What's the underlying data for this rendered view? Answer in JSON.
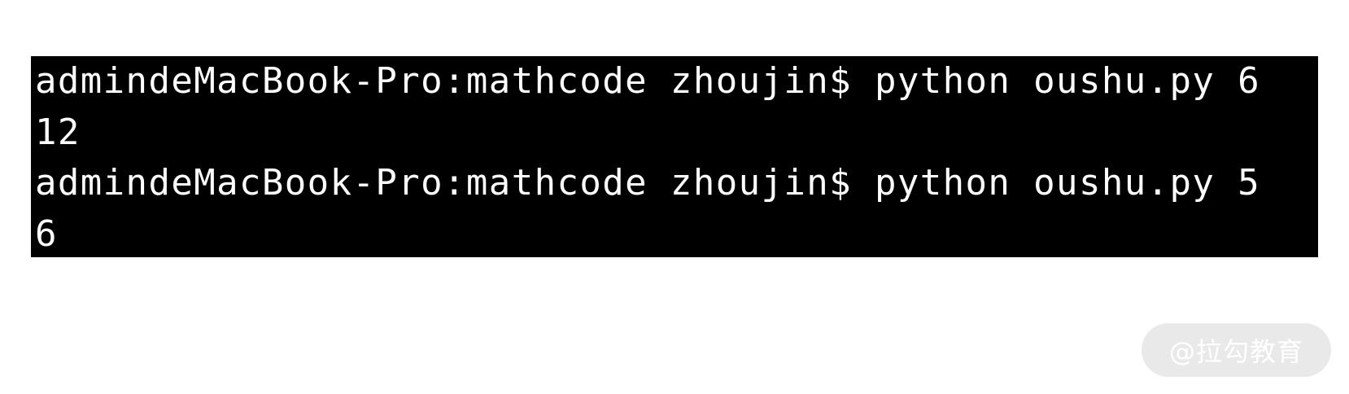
{
  "terminal": {
    "background": "#000000",
    "foreground": "#ffffff",
    "lines": [
      "admindeMacBook-Pro:mathcode zhoujin$ python oushu.py 6",
      "12",
      "admindeMacBook-Pro:mathcode zhoujin$ python oushu.py 5",
      "6"
    ]
  },
  "watermark": {
    "text": "@拉勾教育"
  }
}
